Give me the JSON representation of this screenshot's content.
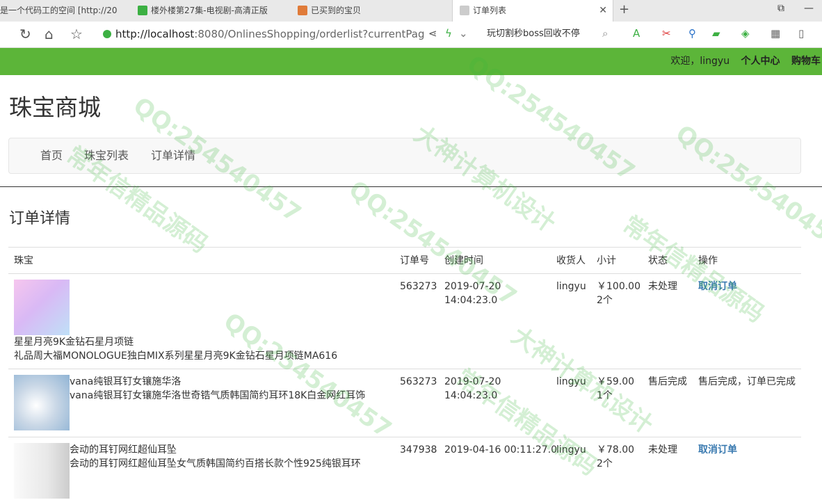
{
  "browser": {
    "tabs": [
      {
        "label": "是一个代码工的空间 [http://20",
        "color": "#888888"
      },
      {
        "label": "楼外楼第27集-电视剧-高清正版",
        "color": "#3cb043"
      },
      {
        "label": "已买到的宝贝",
        "color": "#e07b39"
      },
      {
        "label": "订单列表",
        "color": "#666666"
      }
    ],
    "url_host": "http://localhost",
    "url_rest": ":8080/OnlinesShopping/orderlist?currentPag",
    "search_text": "玩切割秒boss回收不停"
  },
  "site": {
    "welcome": "欢迎，lingyu",
    "profile_link": "个人中心",
    "cart_link": "购物车",
    "logo": "珠宝商城",
    "nav": [
      "首页",
      "珠宝列表",
      "订单详情"
    ],
    "section_title": "订单详情"
  },
  "table": {
    "headers": [
      "珠宝",
      "订单号",
      "创建时间",
      "收货人",
      "小计",
      "状态",
      "操作"
    ],
    "rows": [
      {
        "name": "星星月亮9K金钻石星月项链",
        "desc": "礼品周大福MONOLOGUE独白MIX系列星星月亮9K金钻石星月项链MA616",
        "order_no": "563273",
        "date": "2019-07-20",
        "time": "14:04:23.0",
        "receiver": "lingyu",
        "price": "￥100.00",
        "qty": "2个",
        "status": "未处理",
        "action": "取消订单"
      },
      {
        "name": "vana纯银耳钉女镶施华洛",
        "desc": "vana纯银耳钉女镶施华洛世奇锆气质韩国简约耳环18K白金网红耳饰",
        "order_no": "563273",
        "date": "2019-07-20",
        "time": "14:04:23.0",
        "receiver": "lingyu",
        "price": "￥59.00",
        "qty": "1个",
        "status": "售后完成",
        "action": "售后完成，订单已完成"
      },
      {
        "name": "会动的耳钉网红超仙耳坠",
        "desc": "会动的耳钉网红超仙耳坠女气质韩国简约百搭长款个性925纯银耳环",
        "order_no": "347938",
        "datetime": "2019-04-16 00:11:27.0",
        "receiver": "lingyu",
        "price": "￥78.00",
        "qty": "2个",
        "status": "未处理",
        "action": "取消订单"
      }
    ]
  },
  "watermarks": [
    "QQ:254540457",
    "常年信精品源码",
    "大神计算机设计"
  ]
}
